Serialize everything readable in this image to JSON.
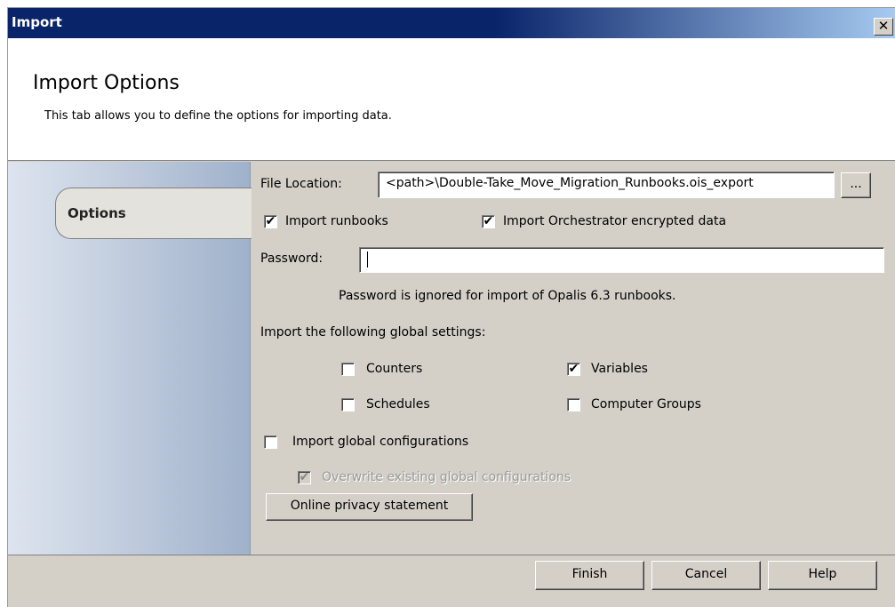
{
  "window": {
    "title": "Import",
    "close_glyph": "✕"
  },
  "header": {
    "title": "Import Options",
    "subtitle": "This tab allows you to define the options for importing data."
  },
  "sidebar": {
    "tabs": [
      {
        "label": "Options",
        "selected": true
      }
    ]
  },
  "form": {
    "file_location_label": "File Location:",
    "file_location_value": "<path>\\Double-Take_Move_Migration_Runbooks.ois_export",
    "browse_label": "...",
    "import_runbooks": {
      "label": "Import runbooks",
      "checked": true,
      "mark": "✔"
    },
    "import_encrypted": {
      "label": "Import Orchestrator encrypted data",
      "checked": true,
      "mark": "✔"
    },
    "password_label": "Password:",
    "password_value": "",
    "password_note": "Password is ignored for import of Opalis 6.3 runbooks.",
    "global_settings_label": "Import the following global settings:",
    "counters": {
      "label": "Counters",
      "checked": false,
      "mark": ""
    },
    "variables": {
      "label": "Variables",
      "checked": true,
      "mark": "✔"
    },
    "schedules": {
      "label": "Schedules",
      "checked": false,
      "mark": ""
    },
    "computer_groups": {
      "label": "Computer Groups",
      "checked": false,
      "mark": ""
    },
    "import_global_configs": {
      "label": "Import global configurations",
      "checked": false,
      "mark": ""
    },
    "overwrite_global_configs": {
      "label": "Overwrite existing global configurations",
      "checked": true,
      "enabled": false,
      "mark": "✔"
    },
    "privacy_button": "Online privacy statement"
  },
  "footer": {
    "finish": "Finish",
    "cancel": "Cancel",
    "help": "Help"
  }
}
